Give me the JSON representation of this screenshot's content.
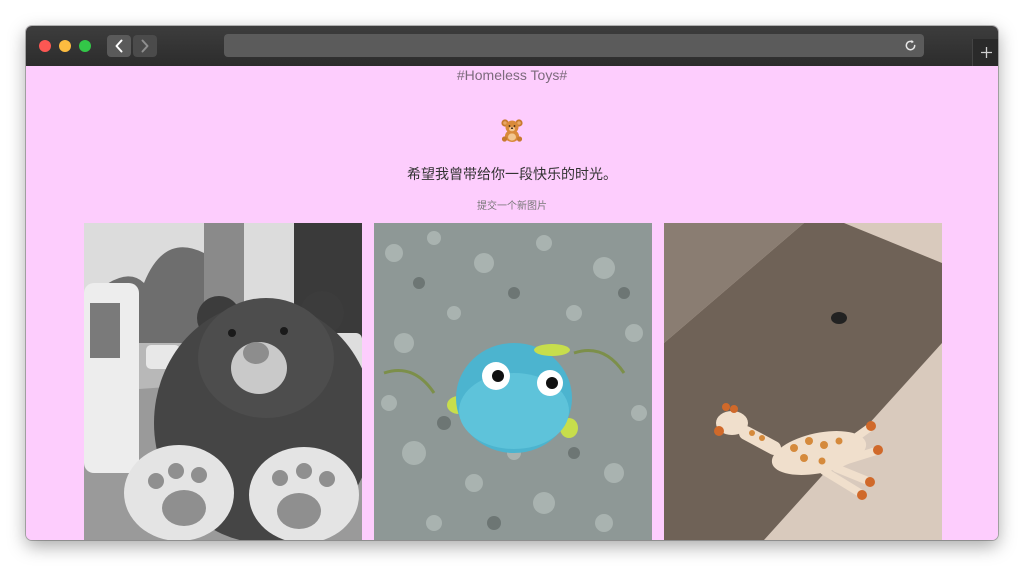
{
  "browser": {
    "url": "",
    "buttons": [
      "back",
      "forward",
      "reload",
      "new-tab"
    ]
  },
  "page": {
    "title": "#Homeless Toys#",
    "icon": "teddy-bear-icon",
    "tagline": "希望我曾带给你一段快乐的时光。",
    "submit_link": "提交一个新图片",
    "background_color": "#fdcdfd"
  },
  "gallery": {
    "photos": [
      {
        "subject": "teddy-bear-photo"
      },
      {
        "subject": "blue-plush-toy-photo"
      },
      {
        "subject": "toy-giraffe-photo"
      }
    ]
  }
}
